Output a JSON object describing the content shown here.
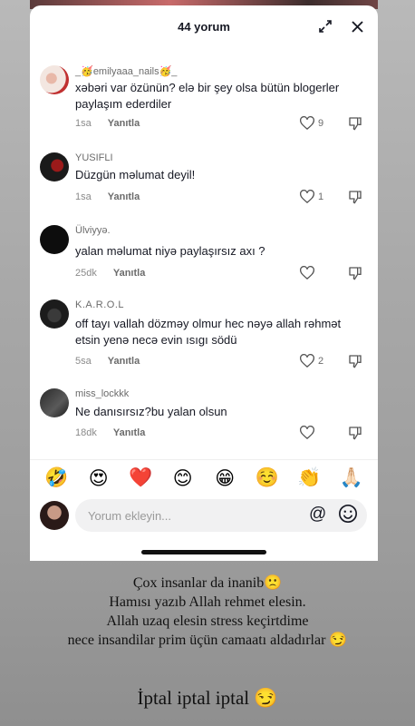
{
  "header": {
    "title": "44 yorum"
  },
  "comments": [
    {
      "user": "_🥳emilyaaa_nails🥳_",
      "text": "xəbəri var özünün? elə bir şey olsa bütün blogerler paylaşım ederdiler",
      "time": "1sa",
      "reply": "Yanıtla",
      "likes": "9"
    },
    {
      "user": "YUSIFLI",
      "text": "Düzgün məlumat deyil!",
      "time": "1sa",
      "reply": "Yanıtla",
      "likes": "1"
    },
    {
      "user": "Ülviyyə.",
      "text": "yalan məlumat niyə paylaşırsız axı ?",
      "time": "25dk",
      "reply": "Yanıtla",
      "likes": ""
    },
    {
      "user": "K.A.R.O.L",
      "text": "off tayı vallah dözməy olmur hec nəyə allah rəhmət etsin yenə necə evin ısıgı södü",
      "time": "5sa",
      "reply": "Yanıtla",
      "likes": "2"
    },
    {
      "user": "miss_lockkk",
      "text": "Ne danısırsız?bu yalan olsun",
      "time": "18dk",
      "reply": "Yanıtla",
      "likes": ""
    }
  ],
  "emoji_bar": [
    "🤣",
    "😍",
    "❤️",
    "😊",
    "😁",
    "☺️",
    "👏",
    "🙏🏻"
  ],
  "input": {
    "placeholder": "Yorum ekleyin..."
  },
  "caption": {
    "lines": [
      "Çox insanlar da inanib🙁",
      "Hamısı yazıb Allah rehmet elesin.",
      "Allah uzaq elesin stress keçirtdime",
      "nece insandilar prim üçün camaatı aldadırlar 😏"
    ],
    "big": "İptal iptal iptal 😏"
  },
  "colors": {
    "text": "#161823",
    "muted": "#8a8a8a",
    "sheet": "#ffffff",
    "background": "#a8a8a8"
  }
}
